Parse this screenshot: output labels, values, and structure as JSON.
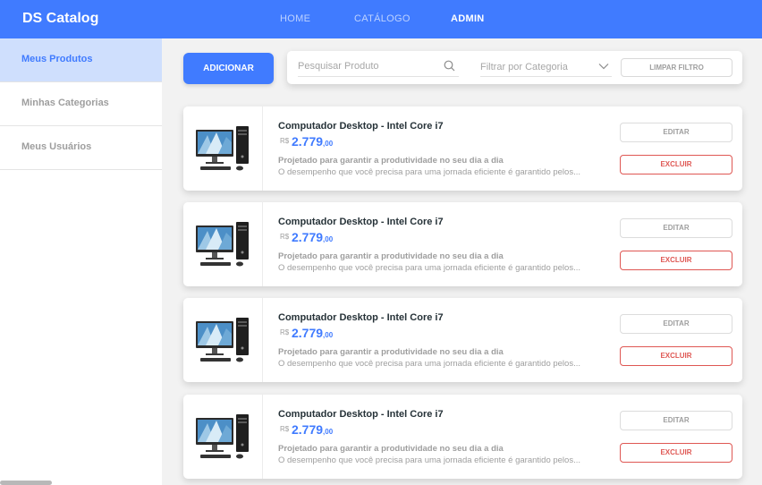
{
  "navbar": {
    "brand": "DS Catalog",
    "links": [
      "HOME",
      "CATÁLOGO",
      "ADMIN"
    ],
    "active_link": "ADMIN",
    "color": "#407bff"
  },
  "sidebar": {
    "items": [
      "Meus Produtos",
      "Minhas Categorias",
      "Meus Usuários"
    ],
    "active_item": "Meus Produtos"
  },
  "toolbar": {
    "add_label": "ADICIONAR",
    "search_placeholder": "Pesquisar Produto",
    "search_icon": "search-icon",
    "category_placeholder": "Filtrar por Categoria",
    "clear_label": "LIMPAR FILTRO"
  },
  "products": [
    {
      "title": "Computador Desktop - Intel Core i7",
      "currency": "R$",
      "price_main": "2.779",
      "price_cents": ",00",
      "subtitle": "Projetado para garantir a produtividade no seu dia a dia",
      "description": "O desempenho que você precisa para uma jornada eficiente é garantido pelos...",
      "edit_label": "EDITAR",
      "delete_label": "EXCLUIR"
    },
    {
      "title": "Computador Desktop - Intel Core i7",
      "currency": "R$",
      "price_main": "2.779",
      "price_cents": ",00",
      "subtitle": "Projetado para garantir a produtividade no seu dia a dia",
      "description": "O desempenho que você precisa para uma jornada eficiente é garantido pelos...",
      "edit_label": "EDITAR",
      "delete_label": "EXCLUIR"
    },
    {
      "title": "Computador Desktop - Intel Core i7",
      "currency": "R$",
      "price_main": "2.779",
      "price_cents": ",00",
      "subtitle": "Projetado para garantir a produtividade no seu dia a dia",
      "description": "O desempenho que você precisa para uma jornada eficiente é garantido pelos...",
      "edit_label": "EDITAR",
      "delete_label": "EXCLUIR"
    },
    {
      "title": "Computador Desktop - Intel Core i7",
      "currency": "R$",
      "price_main": "2.779",
      "price_cents": ",00",
      "subtitle": "Projetado para garantir a produtividade no seu dia a dia",
      "description": "O desempenho que você precisa para uma jornada eficiente é garantido pelos...",
      "edit_label": "EDITAR",
      "delete_label": "EXCLUIR"
    }
  ],
  "colors": {
    "primary": "#407bff",
    "danger": "#df5753",
    "muted_text": "#9e9e9e",
    "title_text": "#263238"
  }
}
